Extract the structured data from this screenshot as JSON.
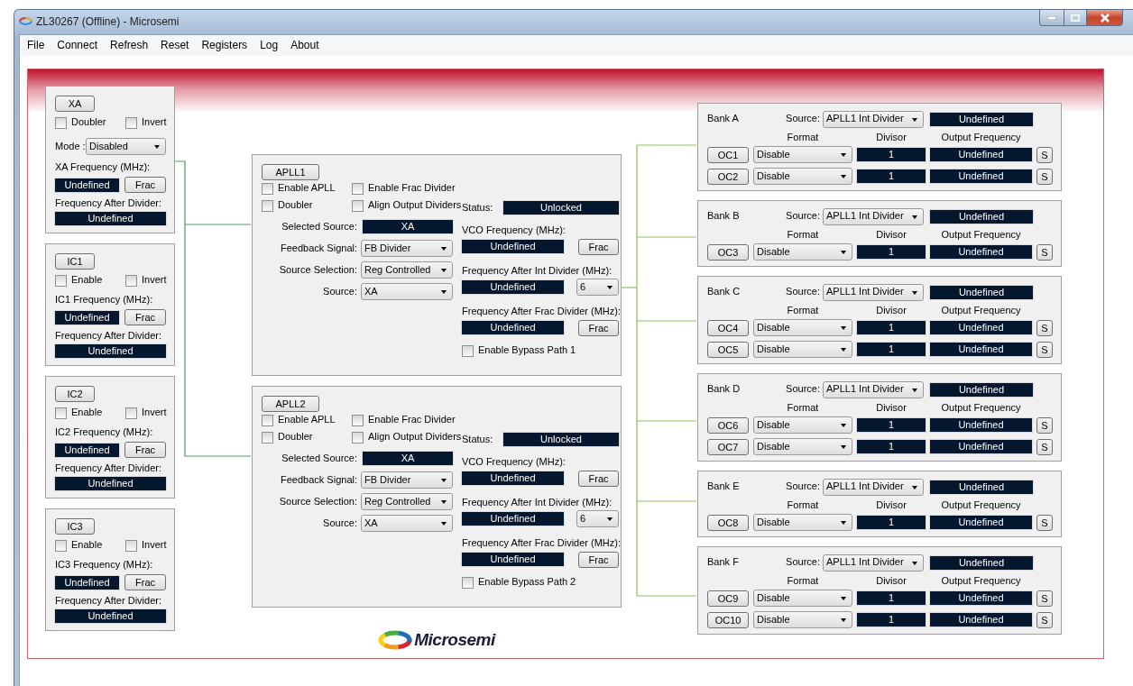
{
  "window": {
    "title": "ZL30267 (Offline) - Microsemi"
  },
  "menu": [
    "File",
    "Connect",
    "Refresh",
    "Reset",
    "Registers",
    "Log",
    "About"
  ],
  "inputs": [
    {
      "button": "XA",
      "checkboxes": [
        {
          "label": "Doubler",
          "checked": false
        },
        {
          "label": "Invert",
          "checked": false
        }
      ],
      "mode": {
        "label": "Mode :",
        "value": "Disabled"
      },
      "freq_label": "XA Frequency (MHz):",
      "freq_value": "Undefined",
      "frac_button": "Frac",
      "after_label": "Frequency After Divider:",
      "after_value": "Undefined"
    },
    {
      "button": "IC1",
      "checkboxes": [
        {
          "label": "Enable",
          "checked": false
        },
        {
          "label": "Invert",
          "checked": false
        }
      ],
      "freq_label": "IC1 Frequency (MHz):",
      "freq_value": "Undefined",
      "frac_button": "Frac",
      "after_label": "Frequency After Divider:",
      "after_value": "Undefined"
    },
    {
      "button": "IC2",
      "checkboxes": [
        {
          "label": "Enable",
          "checked": false
        },
        {
          "label": "Invert",
          "checked": false
        }
      ],
      "freq_label": "IC2 Frequency (MHz):",
      "freq_value": "Undefined",
      "frac_button": "Frac",
      "after_label": "Frequency After Divider:",
      "after_value": "Undefined"
    },
    {
      "button": "IC3",
      "checkboxes": [
        {
          "label": "Enable",
          "checked": false
        },
        {
          "label": "Invert",
          "checked": false
        }
      ],
      "freq_label": "IC3 Frequency (MHz):",
      "freq_value": "Undefined",
      "frac_button": "Frac",
      "after_label": "Frequency After Divider:",
      "after_value": "Undefined"
    }
  ],
  "aplls": [
    {
      "button": "APLL1",
      "checkboxes": [
        {
          "label": "Enable APLL",
          "checked": false
        },
        {
          "label": "Enable Frac Divider",
          "checked": false
        },
        {
          "label": "Doubler",
          "checked": false
        },
        {
          "label": "Align Output Dividers",
          "checked": false
        }
      ],
      "fields": [
        {
          "kind": "display",
          "label": "Selected Source:",
          "value": "XA"
        },
        {
          "kind": "dropdown",
          "label": "Feedback Signal:",
          "value": "FB Divider"
        },
        {
          "kind": "dropdown",
          "label": "Source Selection:",
          "value": "Reg Controlled"
        },
        {
          "kind": "dropdown",
          "label": "Source:",
          "value": "XA"
        }
      ],
      "status": {
        "label": "Status:",
        "value": "Unlocked"
      },
      "readings": [
        {
          "label": "VCO Frequency (MHz):",
          "value": "Undefined",
          "kind": "button",
          "control": "Frac"
        },
        {
          "label": "Frequency After Int Divider (MHz):",
          "value": "Undefined",
          "kind": "dropdown",
          "control": "6"
        },
        {
          "label": "Frequency After Frac Divider (MHz):",
          "value": "Undefined",
          "kind": "button",
          "control": "Frac"
        }
      ],
      "bypass": {
        "label": "Enable Bypass Path 1",
        "checked": false
      }
    },
    {
      "button": "APLL2",
      "checkboxes": [
        {
          "label": "Enable APLL",
          "checked": false
        },
        {
          "label": "Enable Frac Divider",
          "checked": false
        },
        {
          "label": "Doubler",
          "checked": false
        },
        {
          "label": "Align Output Dividers",
          "checked": false
        }
      ],
      "fields": [
        {
          "kind": "display",
          "label": "Selected Source:",
          "value": "XA"
        },
        {
          "kind": "dropdown",
          "label": "Feedback Signal:",
          "value": "FB Divider"
        },
        {
          "kind": "dropdown",
          "label": "Source Selection:",
          "value": "Reg Controlled"
        },
        {
          "kind": "dropdown",
          "label": "Source:",
          "value": "XA"
        }
      ],
      "status": {
        "label": "Status:",
        "value": "Unlocked"
      },
      "readings": [
        {
          "label": "VCO Frequency (MHz):",
          "value": "Undefined",
          "kind": "button",
          "control": "Frac"
        },
        {
          "label": "Frequency After Int Divider (MHz):",
          "value": "Undefined",
          "kind": "dropdown",
          "control": "6"
        },
        {
          "label": "Frequency After Frac Divider (MHz):",
          "value": "Undefined",
          "kind": "button",
          "control": "Frac"
        }
      ],
      "bypass": {
        "label": "Enable Bypass Path 2",
        "checked": false
      }
    }
  ],
  "logo": {
    "text": "Microsemi"
  },
  "banks": [
    {
      "name": "Bank A",
      "source_label": "Source:",
      "source": "APLL1 Int Divider",
      "frequency": "Undefined",
      "headers": [
        "Format",
        "Divisor",
        "Output Frequency"
      ],
      "outputs": [
        {
          "button": "OC1",
          "format": "Disable",
          "divisor": "1",
          "frequency": "Undefined",
          "s_button": "S"
        },
        {
          "button": "OC2",
          "format": "Disable",
          "divisor": "1",
          "frequency": "Undefined",
          "s_button": "S"
        }
      ]
    },
    {
      "name": "Bank B",
      "source_label": "Source:",
      "source": "APLL1 Int Divider",
      "frequency": "Undefined",
      "headers": [
        "Format",
        "Divisor",
        "Output Frequency"
      ],
      "outputs": [
        {
          "button": "OC3",
          "format": "Disable",
          "divisor": "1",
          "frequency": "Undefined",
          "s_button": "S"
        }
      ]
    },
    {
      "name": "Bank C",
      "source_label": "Source:",
      "source": "APLL1 Int Divider",
      "frequency": "Undefined",
      "headers": [
        "Format",
        "Divisor",
        "Output Frequency"
      ],
      "outputs": [
        {
          "button": "OC4",
          "format": "Disable",
          "divisor": "1",
          "frequency": "Undefined",
          "s_button": "S"
        },
        {
          "button": "OC5",
          "format": "Disable",
          "divisor": "1",
          "frequency": "Undefined",
          "s_button": "S"
        }
      ]
    },
    {
      "name": "Bank D",
      "source_label": "Source:",
      "source": "APLL1 Int Divider",
      "frequency": "Undefined",
      "headers": [
        "Format",
        "Divisor",
        "Output Frequency"
      ],
      "outputs": [
        {
          "button": "OC6",
          "format": "Disable",
          "divisor": "1",
          "frequency": "Undefined",
          "s_button": "S"
        },
        {
          "button": "OC7",
          "format": "Disable",
          "divisor": "1",
          "frequency": "Undefined",
          "s_button": "S"
        }
      ]
    },
    {
      "name": "Bank E",
      "source_label": "Source:",
      "source": "APLL1 Int Divider",
      "frequency": "Undefined",
      "headers": [
        "Format",
        "Divisor",
        "Output Frequency"
      ],
      "outputs": [
        {
          "button": "OC8",
          "format": "Disable",
          "divisor": "1",
          "frequency": "Undefined",
          "s_button": "S"
        }
      ]
    },
    {
      "name": "Bank F",
      "source_label": "Source:",
      "source": "APLL1 Int Divider",
      "frequency": "Undefined",
      "headers": [
        "Format",
        "Divisor",
        "Output Frequency"
      ],
      "outputs": [
        {
          "button": "OC9",
          "format": "Disable",
          "divisor": "1",
          "frequency": "Undefined",
          "s_button": "S"
        },
        {
          "button": "OC10",
          "format": "Disable",
          "divisor": "1",
          "frequency": "Undefined",
          "s_button": "S"
        }
      ]
    }
  ]
}
